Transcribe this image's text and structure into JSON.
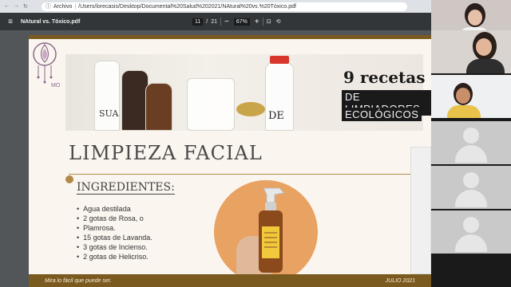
{
  "browser": {
    "info_label": "Archivo",
    "url": "/Users/lorecasis/Desktop/Documental%20Salud%202021/NAtural%20vs.%20Tóxico.pdf"
  },
  "pdf_toolbar": {
    "file_name": "NAtural vs. Tóxico.pdf",
    "current_page": "11",
    "page_separator": "/",
    "total_pages": "21",
    "zoom": "67%"
  },
  "slide": {
    "logo_text": "MO",
    "heading_number": "9 recetas",
    "tag_line_1": "DE LIMPIADORES",
    "tag_line_2": "ECOLÓGICOS",
    "jar_labels": [
      "SUA",
      "DE"
    ],
    "section_title": "LIMPIEZA FACIAL",
    "ingredients_title": "INGREDIENTES:",
    "ingredients": [
      "Agua destilada",
      "2 gotas de Rosa, o",
      "Plamrosa.",
      "15 gotas de Lavanda.",
      "3 gotas de Incienso.",
      "2 gotas de Helicriso."
    ],
    "footer_left": "Mira lo fácil que puede ser.",
    "footer_right": "JULIO 2021"
  },
  "participants": 6,
  "colors": {
    "accent_gold": "#b08a48",
    "footer_brown": "#7a5a1e",
    "circle_orange": "#e8a262"
  }
}
